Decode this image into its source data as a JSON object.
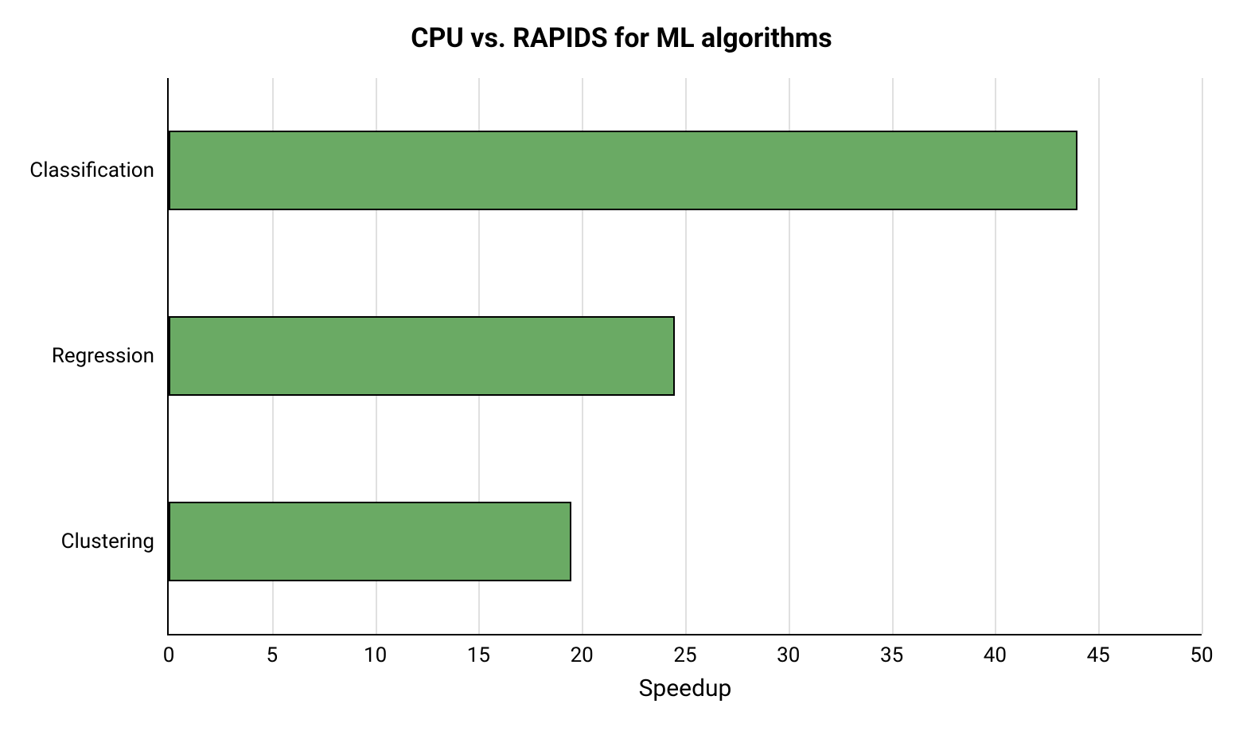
{
  "chart_data": {
    "type": "bar",
    "orientation": "horizontal",
    "title": "CPU vs. RAPIDS for ML algorithms",
    "xlabel": "Speedup",
    "ylabel": "",
    "categories": [
      "Classification",
      "Regression",
      "Clustering"
    ],
    "values": [
      44,
      24.5,
      19.5
    ],
    "xlim": [
      0,
      50
    ],
    "x_ticks": [
      0,
      5,
      10,
      15,
      20,
      25,
      30,
      35,
      40,
      45,
      50
    ],
    "bar_color": "#6aaa64",
    "grid": true
  }
}
